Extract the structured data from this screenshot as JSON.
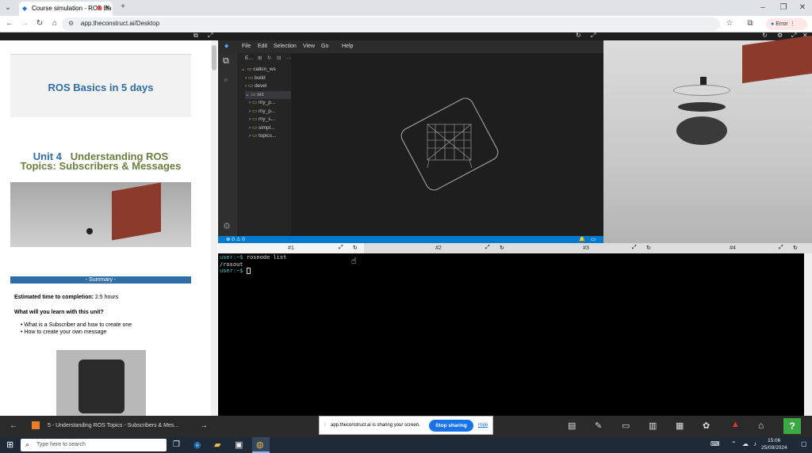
{
  "browser": {
    "tab_title": "Course simulation - ROS Ba",
    "url": "app.theconstruct.ai/Desktop",
    "error_label": "Error"
  },
  "lesson": {
    "course_title": "ROS Basics in 5 days",
    "unit_prefix": "Unit 4",
    "unit_title_rest": "Understanding ROS",
    "unit_title_line2": "Topics: Subscribers & Messages",
    "summary_label": "- Summary -",
    "estimated_label": "Estimated time to completion:",
    "estimated_value": "2.5 hours",
    "learn_heading": "What will you learn with this unit?",
    "learn_items": [
      "What is a Subscriber and how to create one",
      "How to create your own message"
    ]
  },
  "ide": {
    "menu": [
      "File",
      "Edit",
      "Selection",
      "View",
      "Go",
      "Help"
    ],
    "explorer_header": "E...",
    "tree": [
      {
        "label": "catkin_ws",
        "indent": 1,
        "type": "folder-open"
      },
      {
        "label": "build",
        "indent": 2,
        "type": "folder"
      },
      {
        "label": "devel",
        "indent": 2,
        "type": "folder"
      },
      {
        "label": "src",
        "indent": 2,
        "type": "folder-open"
      },
      {
        "label": "my_p...",
        "indent": 3,
        "type": "folder"
      },
      {
        "label": "my_p...",
        "indent": 3,
        "type": "folder"
      },
      {
        "label": "my_s...",
        "indent": 3,
        "type": "folder"
      },
      {
        "label": "simpl...",
        "indent": 3,
        "type": "folder"
      },
      {
        "label": "topics...",
        "indent": 3,
        "type": "folder"
      }
    ],
    "status_left": "⊗ 0 ⚠ 0"
  },
  "terminals": {
    "tabs": [
      "#1",
      "#2",
      "#3",
      "#4"
    ],
    "lines": [
      {
        "prompt": "user:~$",
        "text": " rosnode list"
      },
      {
        "prompt": "",
        "text": "/rosout"
      },
      {
        "prompt": "user:~$",
        "text": " "
      }
    ]
  },
  "appbar": {
    "tab_title": "5 - Understanding ROS Topics - Subscribers & Mes..."
  },
  "share_bar": {
    "message": "app.theconstruct.ai is sharing your screen.",
    "stop_label": "Stop sharing",
    "hide_label": "Hide"
  },
  "taskbar": {
    "search_placeholder": "Type here to search",
    "time": "15:06",
    "date": "25/09/2024"
  },
  "colors": {
    "accent": "#2f6da6",
    "ide_status": "#007acc",
    "prompt": "#3fc3c3"
  }
}
